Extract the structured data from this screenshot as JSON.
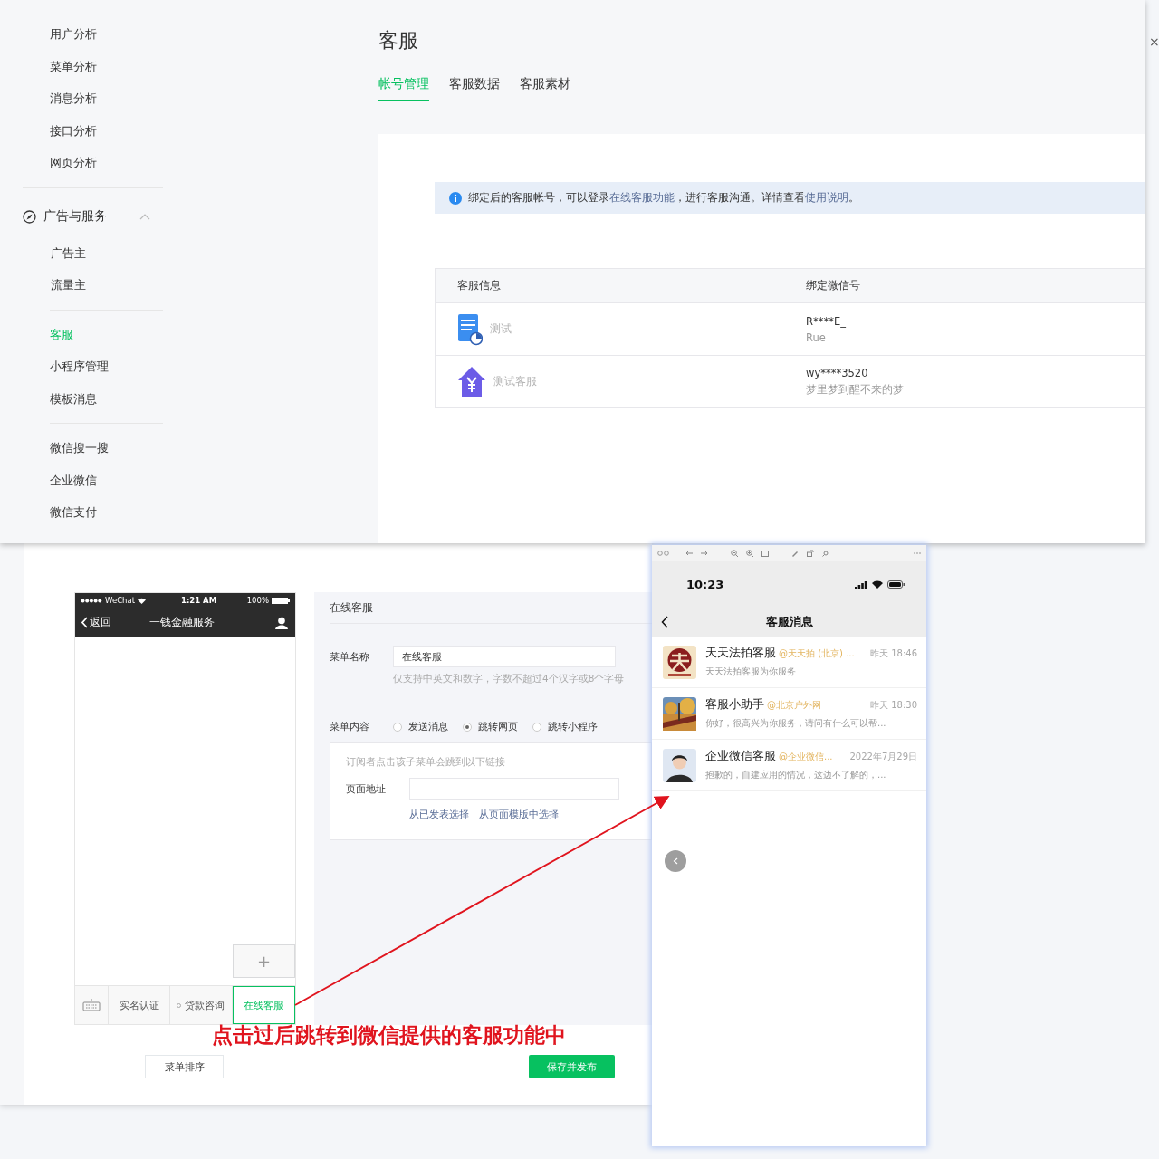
{
  "admin_window": {
    "sidebar": {
      "groups": [
        {
          "items": [
            {
              "label": "用户分析",
              "selected": false
            },
            {
              "label": "菜单分析",
              "selected": false
            },
            {
              "label": "消息分析",
              "selected": false
            },
            {
              "label": "接口分析",
              "selected": false
            },
            {
              "label": "网页分析",
              "selected": false
            }
          ]
        },
        {
          "header": {
            "label": "广告与服务",
            "expanded": true
          },
          "items": [
            {
              "label": "广告主",
              "selected": false
            },
            {
              "label": "流量主",
              "selected": false
            }
          ]
        },
        {
          "items": [
            {
              "label": "客服",
              "selected": true
            },
            {
              "label": "小程序管理",
              "selected": false
            },
            {
              "label": "模板消息",
              "selected": false
            }
          ]
        },
        {
          "items": [
            {
              "label": "微信搜一搜",
              "selected": false
            },
            {
              "label": "企业微信",
              "selected": false
            },
            {
              "label": "微信支付",
              "selected": false
            }
          ]
        }
      ]
    },
    "title": "客服",
    "tabs": [
      {
        "label": "帐号管理",
        "selected": true
      },
      {
        "label": "客服数据",
        "selected": false
      },
      {
        "label": "客服素材",
        "selected": false
      }
    ],
    "notice": [
      {
        "text": "绑定后的客服帐号，可以登录",
        "link": false
      },
      {
        "text": "在线客服功能",
        "link": true
      },
      {
        "text": "，进行客服沟通。详情查看",
        "link": false
      },
      {
        "text": "使用说明",
        "link": true
      },
      {
        "text": "。",
        "link": false
      }
    ],
    "table": {
      "columns": [
        "客服信息",
        "绑定微信号"
      ],
      "rows": [
        {
          "kind": "document",
          "name": "测试",
          "wechat_id": "R****E_",
          "nickname": "Rue"
        },
        {
          "kind": "house",
          "name": "测试客服",
          "wechat_id": "wy****3520",
          "nickname": "梦里梦到醒不来的梦"
        }
      ]
    }
  },
  "close_mark": "×",
  "menu_window": {
    "phone": {
      "carrier": "WeChat",
      "time": "1:21 AM",
      "battery": "100%",
      "back": "返回",
      "title": "一钱金融服务",
      "add": "+",
      "menu": [
        {
          "label": "实名认证",
          "selected": false,
          "dot": false
        },
        {
          "label": "贷款咨询",
          "selected": false,
          "dot": true
        },
        {
          "label": "在线客服",
          "selected": true,
          "dot": false
        }
      ]
    },
    "form": {
      "header": "在线客服",
      "name_label": "菜单名称",
      "name_value": "在线客服",
      "name_hint": "仅支持中英文和数字，字数不超过4个汉字或8个字母",
      "content_label": "菜单内容",
      "options": [
        {
          "label": "发送消息",
          "selected": false
        },
        {
          "label": "跳转网页",
          "selected": true
        },
        {
          "label": "跳转小程序",
          "selected": false
        }
      ],
      "link_hint": "订阅者点击该子菜单会跳到以下链接",
      "url_label": "页面地址",
      "links": [
        "从已发表选择",
        "从页面模版中选择"
      ]
    },
    "sort_button": "菜单排序",
    "publish_button": "保存并发布"
  },
  "annotation": {
    "caption": "点击过后跳转到微信提供的客服功能中"
  },
  "chat_window": {
    "time": "10:23",
    "title": "客服消息",
    "conversations": [
      {
        "kind": "logo",
        "name": "天天法拍客服",
        "org": "@天天拍 (北京) ...",
        "time": "昨天 18:46",
        "preview": "天天法拍客服为你服务"
      },
      {
        "kind": "picture",
        "name": "客服小助手",
        "org": "@北京户外网",
        "time": "昨天 18:30",
        "preview": "你好，很高兴为你服务，请问有什么可以帮..."
      },
      {
        "kind": "person",
        "name": "企业微信客服",
        "org": "@企业微信...",
        "time": "2022年7月29日",
        "preview": "抱歉的，自建应用的情况，这边不了解的，..."
      }
    ]
  }
}
